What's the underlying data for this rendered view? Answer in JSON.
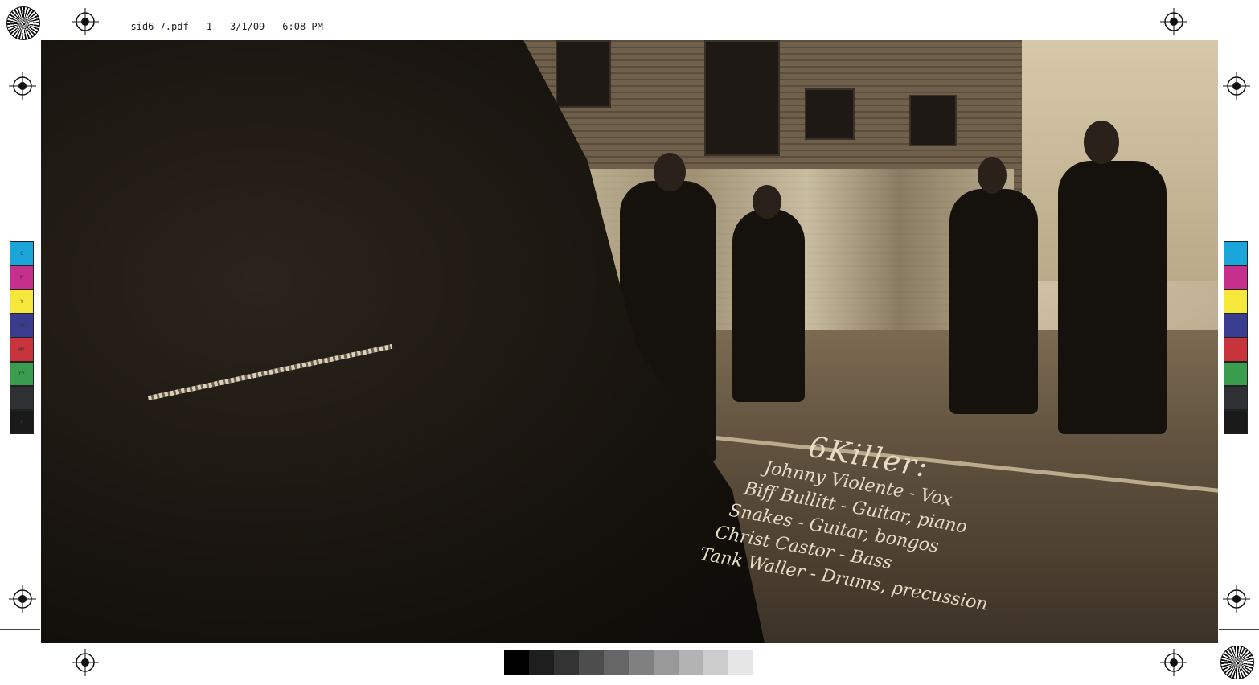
{
  "slug": {
    "filename": "sid6-7.pdf",
    "page": "1",
    "date": "3/1/09",
    "time": "6:08 PM"
  },
  "handwriting": {
    "title": "6Killer:",
    "lines": [
      "Johnny Violente - Vox",
      "Biff Bullitt - Guitar, piano",
      "Snakes - Guitar, bongos",
      "Christ Castor - Bass",
      "Tank Waller - Drums, precussion"
    ]
  },
  "color_bar_left": [
    {
      "label": "C",
      "color": "#1ba6db"
    },
    {
      "label": "M",
      "color": "#c5308c"
    },
    {
      "label": "Y",
      "color": "#f6e83a"
    },
    {
      "label": "CM",
      "color": "#3a3d8f"
    },
    {
      "label": "MY",
      "color": "#c7343b"
    },
    {
      "label": "CY",
      "color": "#3a9c4e"
    },
    {
      "label": "CMY",
      "color": "#2f3033"
    },
    {
      "label": "K",
      "color": "#1a1a1a"
    }
  ],
  "color_bar_right": [
    {
      "color": "#1ba6db"
    },
    {
      "color": "#c5308c"
    },
    {
      "color": "#f6e83a"
    },
    {
      "color": "#3a3d8f"
    },
    {
      "color": "#c7343b"
    },
    {
      "color": "#3a9c4e"
    },
    {
      "color": "#2f3033"
    },
    {
      "color": "#1a1a1a"
    }
  ],
  "grey_scale": [
    "#000000",
    "#1e1e1e",
    "#333333",
    "#4d4d4d",
    "#666666",
    "#808080",
    "#999999",
    "#b3b3b3",
    "#cccccc",
    "#e6e6e6"
  ],
  "icons": {
    "registration": "registration-mark-icon",
    "starburst": "star-target-icon"
  }
}
